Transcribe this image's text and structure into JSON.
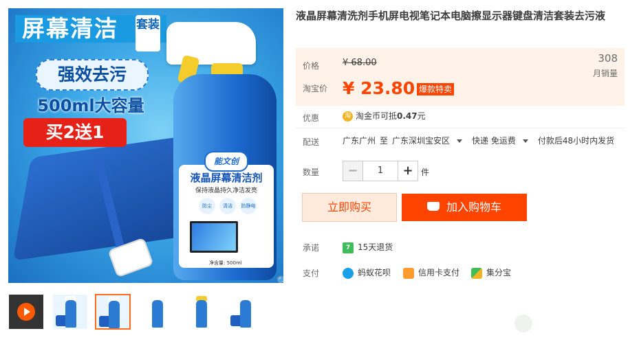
{
  "product": {
    "title": "液晶屏幕清洗剂手机屏电视笔记本电脑擦显示器键盘清洁套装去污液",
    "image_texts": {
      "banner_title": "屏幕清洁",
      "banner_tag": "套装",
      "pill": "强效去污",
      "capacity": "500ml大容量",
      "promo": "买2送1",
      "brand": "能文创",
      "label_title": "液晶屏幕清洁剂",
      "label_sub": "保持液晶持久净洁发亮",
      "badges": [
        "防尘",
        "清洁",
        "防静电"
      ],
      "net": "净含量: 500ml"
    }
  },
  "price": {
    "label": "价格",
    "original": "¥ 68.00",
    "taobao_label": "淘宝价",
    "current": "¥ 23.80",
    "badge": "爆款特卖",
    "sales_count": "308",
    "sales_label": "月销量"
  },
  "promo": {
    "label": "优惠",
    "icon": "淘",
    "text_prefix": "淘金币可抵",
    "amount": "0.47",
    "suffix": "元"
  },
  "shipping": {
    "label": "配送",
    "from": "广东广州",
    "to_word": "至",
    "to": "广东深圳宝安区",
    "method": "快递 免运费",
    "note": "付款后48小时内发货"
  },
  "quantity": {
    "label": "数量",
    "value": "1",
    "minus": "−",
    "plus": "+",
    "unit": "件"
  },
  "actions": {
    "buy_now": "立即购买",
    "add_cart": "加入购物车"
  },
  "promise": {
    "label": "承诺",
    "icon": "7",
    "text": "15天退货"
  },
  "payment": {
    "label": "支付",
    "methods": [
      "蚂蚁花呗",
      "信用卡支付",
      "集分宝"
    ]
  },
  "colors": {
    "accent": "#ff4400",
    "price_bg": "#fff2e8"
  }
}
